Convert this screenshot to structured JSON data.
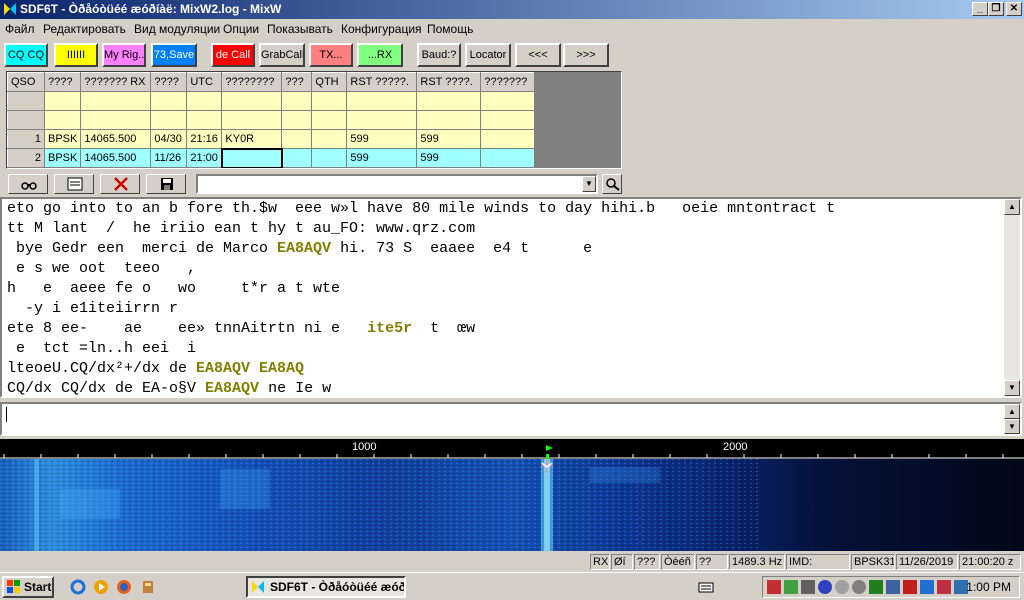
{
  "window": {
    "title": "SDF6T - Òðåóòüéé æóðíàë: MixW2.log - MixW",
    "minimize": "_",
    "maximize": "❐",
    "close": "✕"
  },
  "menu": [
    "Файл",
    "Редактировать",
    "Вид модуляции",
    "Опции",
    "Показывать",
    "Конфигурация",
    "Помощь"
  ],
  "toolbar": {
    "buttons": [
      {
        "label": "CQ CQ",
        "bg": "#00ffff"
      },
      {
        "label": "IIIIII",
        "bg": "#ffff00"
      },
      {
        "label": "My Rig..",
        "bg": "#ff80ff"
      },
      {
        "label": "73,Save",
        "bg": "#0080ff"
      },
      {
        "label": "de Call",
        "bg": "#ff0000"
      },
      {
        "label": "GrabCall",
        "bg": "#d4d0c8"
      },
      {
        "label": "TX...",
        "bg": "#ff8080"
      },
      {
        "label": "...RX",
        "bg": "#80ff80"
      },
      {
        "label": "Baud:?",
        "bg": "#d4d0c8"
      },
      {
        "label": "Locator",
        "bg": "#d4d0c8"
      },
      {
        "label": "<<<",
        "bg": "#d4d0c8"
      },
      {
        "label": ">>>",
        "bg": "#d4d0c8"
      }
    ]
  },
  "log": {
    "columns": [
      "QSO",
      "????",
      "??????? RX",
      "????",
      "UTC",
      "????????",
      "???",
      "QTH",
      "RST ?????.",
      "RST ????.",
      "???????"
    ],
    "rows": [
      {
        "num": "",
        "cells": [
          "",
          "",
          "",
          "",
          "",
          "",
          "",
          "",
          "",
          ""
        ]
      },
      {
        "num": "",
        "cells": [
          "",
          "",
          "",
          "",
          "",
          "",
          "",
          "",
          "",
          ""
        ]
      },
      {
        "num": "1",
        "cells": [
          "BPSK",
          "14065.500",
          "04/30",
          "21:16",
          "KY0R",
          "",
          "",
          "599",
          "599",
          ""
        ]
      },
      {
        "num": "2",
        "cells": [
          "BPSK",
          "14065.500",
          "11/26",
          "21:00",
          "",
          "",
          "",
          "599",
          "599",
          ""
        ]
      }
    ]
  },
  "rx_text": [
    [
      {
        "t": "eto go into to an b fore th.$w  eee w»l have 80 mile winds to day hihi.b   oeie mntontract t",
        "c": false
      }
    ],
    [
      {
        "t": "tt M lant  /  he iriio ean t hy t au_FO: www.qrz.com",
        "c": false
      }
    ],
    [
      {
        "t": " bye Gedr een  merci de Marco ",
        "c": false
      },
      {
        "t": "EA8AQV",
        "c": true
      },
      {
        "t": " hi. 73 S  eaaee  e4 t      e",
        "c": false
      }
    ],
    [
      {
        "t": " e s we oot  teeo   ,",
        "c": false
      }
    ],
    [
      {
        "t": "h   e  aeee fe o   wo     t*r a t wte",
        "c": false
      }
    ],
    [
      {
        "t": "  -y i e1iteiirrn r",
        "c": false
      }
    ],
    [
      {
        "t": "ete 8 ee-    ae    ee» tnnAitrtn ni e   ",
        "c": false
      },
      {
        "t": "ite5r",
        "c": true
      },
      {
        "t": "  t  œw",
        "c": false
      }
    ],
    [
      {
        "t": " e  tct =ln..h eei  i",
        "c": false
      }
    ],
    [
      {
        "t": "lteoeU.CQ/dx²+/dx de ",
        "c": false
      },
      {
        "t": "EA8AQV EA8AQ",
        "c": true
      }
    ],
    [
      {
        "t": "CQ/dx CQ/dx de EA-o§V ",
        "c": false
      },
      {
        "t": "EA8AQV",
        "c": true
      },
      {
        "t": " ne Ie w",
        "c": false
      }
    ]
  ],
  "waterfall": {
    "scale": [
      "1000",
      "2000"
    ]
  },
  "status": {
    "mode": "RX",
    "cell2": "Øí",
    "cell3": "???",
    "cell4": "Òèéñ",
    "cell5": "??",
    "frequency": "1489.3 Hz",
    "imd": "IMD:",
    "modulation": "BPSK31",
    "date": "11/26/2019",
    "time": "21:00:20 z"
  },
  "taskbar": {
    "start": "Start",
    "task": "SDF6T - Òðåóòüéé æóð...",
    "clock": "1:00 PM"
  }
}
